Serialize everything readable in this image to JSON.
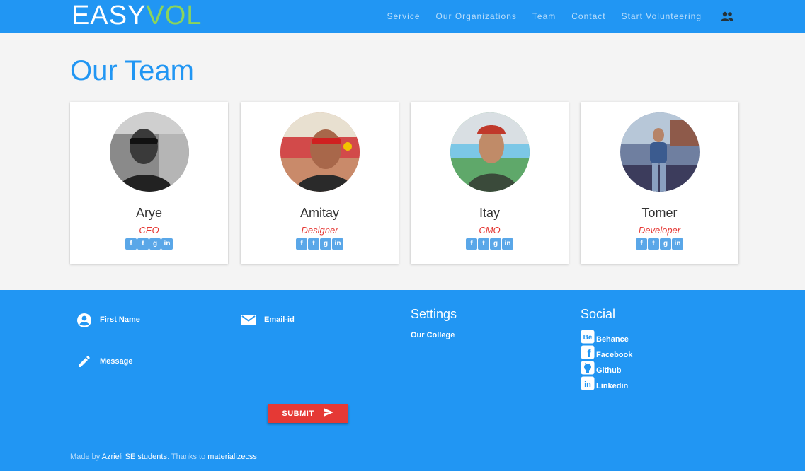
{
  "nav": {
    "logo_part1": "EASY",
    "logo_part2": "VOL",
    "items": [
      "Service",
      "Our Organizations",
      "Team",
      "Contact",
      "Start Volunteering"
    ],
    "account_icon": "people-icon"
  },
  "main": {
    "title": "Our Team",
    "members": [
      {
        "name": "Arye",
        "role": "CEO"
      },
      {
        "name": "Amitay",
        "role": "Designer"
      },
      {
        "name": "Itay",
        "role": "CMO"
      },
      {
        "name": "Tomer",
        "role": "Developer"
      }
    ],
    "social_icons": [
      "facebook-icon",
      "twitter-icon",
      "googleplus-icon",
      "linkedin-icon"
    ]
  },
  "footer": {
    "form": {
      "first_name_label": "First Name",
      "email_label": "Email-id",
      "message_label": "Message",
      "submit_label": "SUBMIT"
    },
    "settings": {
      "heading": "Settings",
      "links": [
        "Our College"
      ]
    },
    "social": {
      "heading": "Social",
      "links": [
        "Behance",
        "Facebook",
        "Github",
        "Linkedin"
      ]
    },
    "credits": {
      "prefix": "Made by ",
      "author": "Azrieli SE students",
      "middle": ". Thanks to ",
      "framework": "materializecss"
    }
  },
  "colors": {
    "primary": "#2196f3",
    "accent": "#e53935",
    "logo_green": "#8bd45a"
  }
}
